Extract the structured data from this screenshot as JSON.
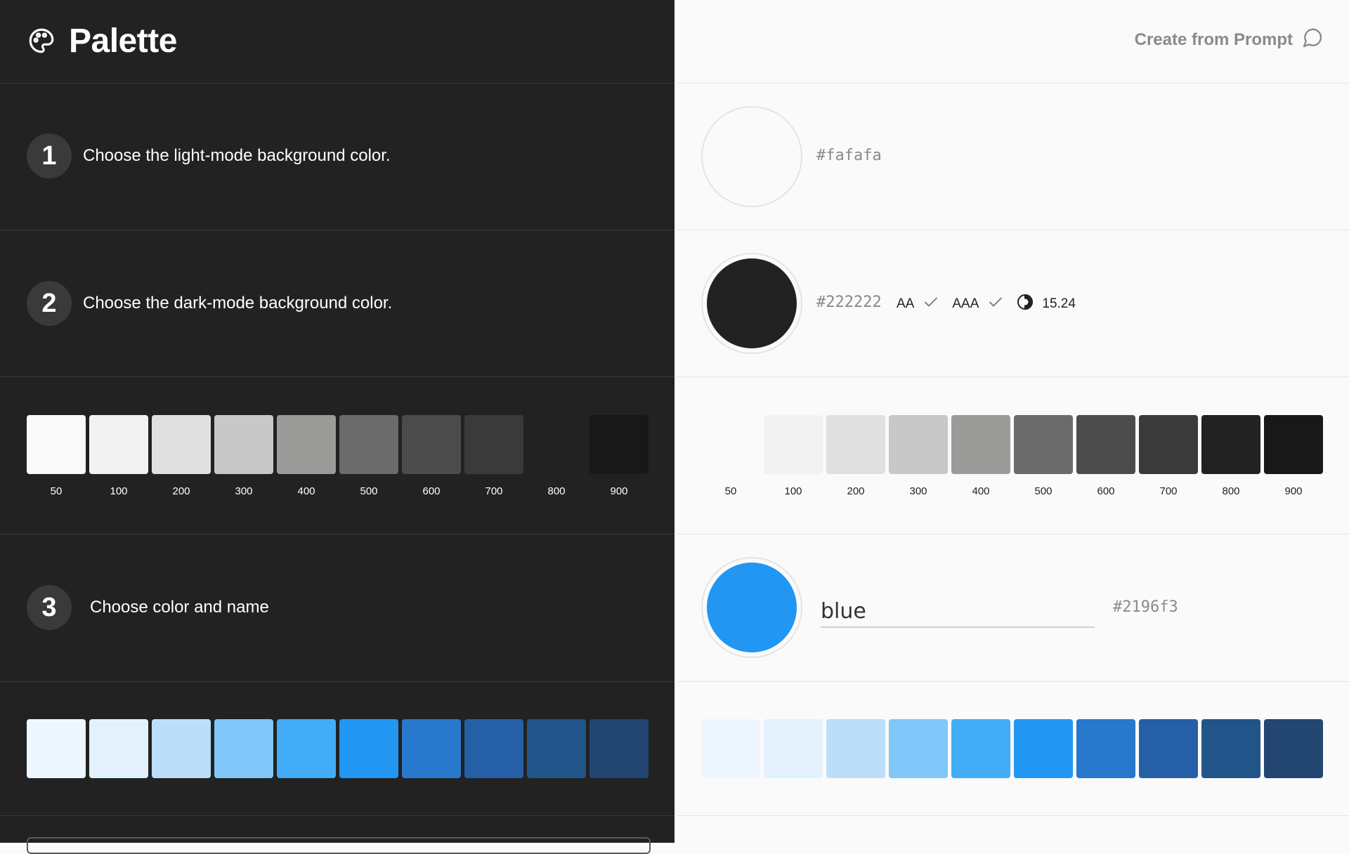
{
  "app": {
    "title": "Palette"
  },
  "header": {
    "create_prompt_label": "Create from Prompt"
  },
  "steps": [
    {
      "number": "1",
      "text": "Choose the light-mode background color."
    },
    {
      "number": "2",
      "text": "Choose the dark-mode background color."
    },
    {
      "number": "3",
      "text": "Choose color and name"
    }
  ],
  "light_bg": {
    "hex": "#fafafa"
  },
  "dark_bg": {
    "hex": "#222222",
    "aa_label": "AA",
    "aaa_label": "AAA",
    "contrast_value": "15.24"
  },
  "color": {
    "name": "blue",
    "hex": "#2196f3"
  },
  "gray_scale": {
    "labels": [
      "50",
      "100",
      "200",
      "300",
      "400",
      "500",
      "600",
      "700",
      "800",
      "900"
    ],
    "colors": [
      "#fafafa",
      "#f1f2f1",
      "#e0e0e0",
      "#c8c8c8",
      "#9b9b9a",
      "#6b6b6b",
      "#4b4b4b",
      "#3a3a3a",
      "#222222",
      "#181818"
    ]
  },
  "blue_scale": {
    "colors": [
      "#eef7ff",
      "#e3f1fd",
      "#bbdefb",
      "#81c7fa",
      "#42adf6",
      "#2196f3",
      "#2878cd",
      "#2560a7",
      "#215589",
      "#234572"
    ]
  }
}
